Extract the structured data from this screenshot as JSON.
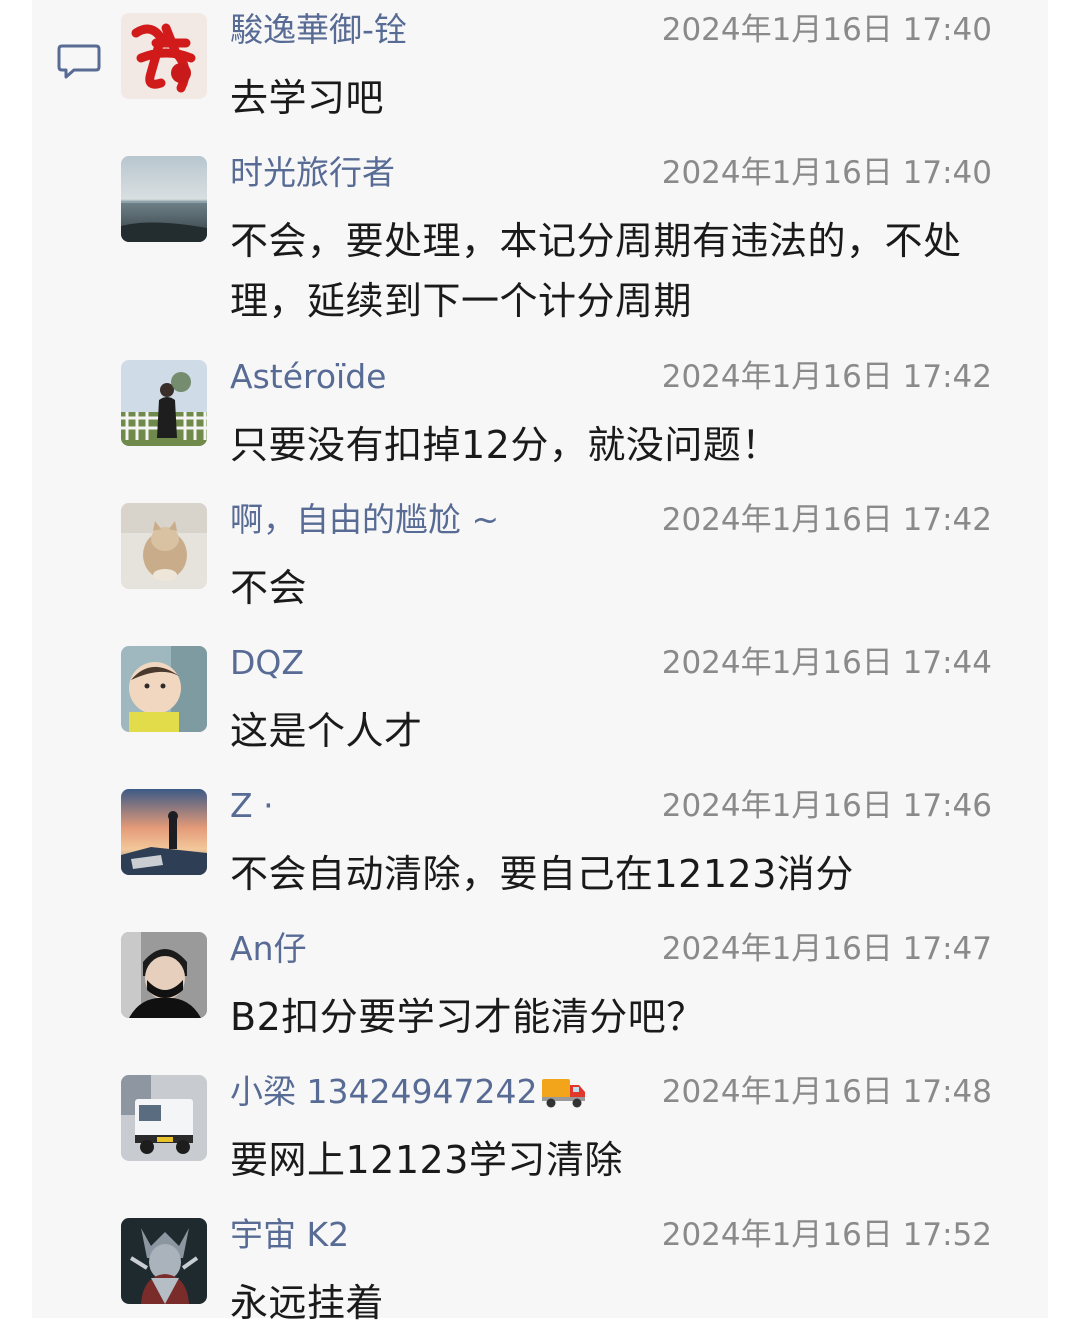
{
  "comments": [
    {
      "name": "駿逸華御-铨",
      "time": "2024年1月16日 17:40",
      "text": "去学习吧",
      "avatar": "red-calligraphy-avatar"
    },
    {
      "name": "时光旅行者",
      "time": "2024年1月16日 17:40",
      "text": "不会，要处理，本记分周期有违法的，不处理，延续到下一个计分周期",
      "avatar": "seaside-avatar"
    },
    {
      "name": "Astéroïde",
      "time": "2024年1月16日 17:42",
      "text": "只要没有扣掉12分，就没问题！",
      "avatar": "fence-person-avatar"
    },
    {
      "name": "啊，自由的尴尬 ~",
      "time": "2024年1月16日 17:42",
      "text": "不会",
      "avatar": "cat-avatar"
    },
    {
      "name": "DQZ",
      "time": "2024年1月16日 17:44",
      "text": "这是个人才",
      "avatar": "baby-avatar"
    },
    {
      "name": "Z ·",
      "time": "2024年1月16日 17:46",
      "text": "不会自动清除，要自己在12123消分",
      "avatar": "sunset-anime-avatar"
    },
    {
      "name": "An仔",
      "time": "2024年1月16日 17:47",
      "text": "B2扣分要学习才能清分吧？",
      "avatar": "masked-man-avatar"
    },
    {
      "name": "小梁 13424947242",
      "time": "2024年1月16日 17:48",
      "text": "要网上12123学习清除",
      "avatar": "truck-avatar",
      "badge_icon": "delivery-truck-icon"
    },
    {
      "name": "宇宙 K2",
      "time": "2024年1月16日 17:52",
      "text": "永远挂着",
      "avatar": "armored-warrior-avatar"
    }
  ],
  "colors": {
    "name": "#576b95",
    "time": "#8a8a8a",
    "text": "#1a1a1a",
    "panel": "#f7f7f7"
  }
}
